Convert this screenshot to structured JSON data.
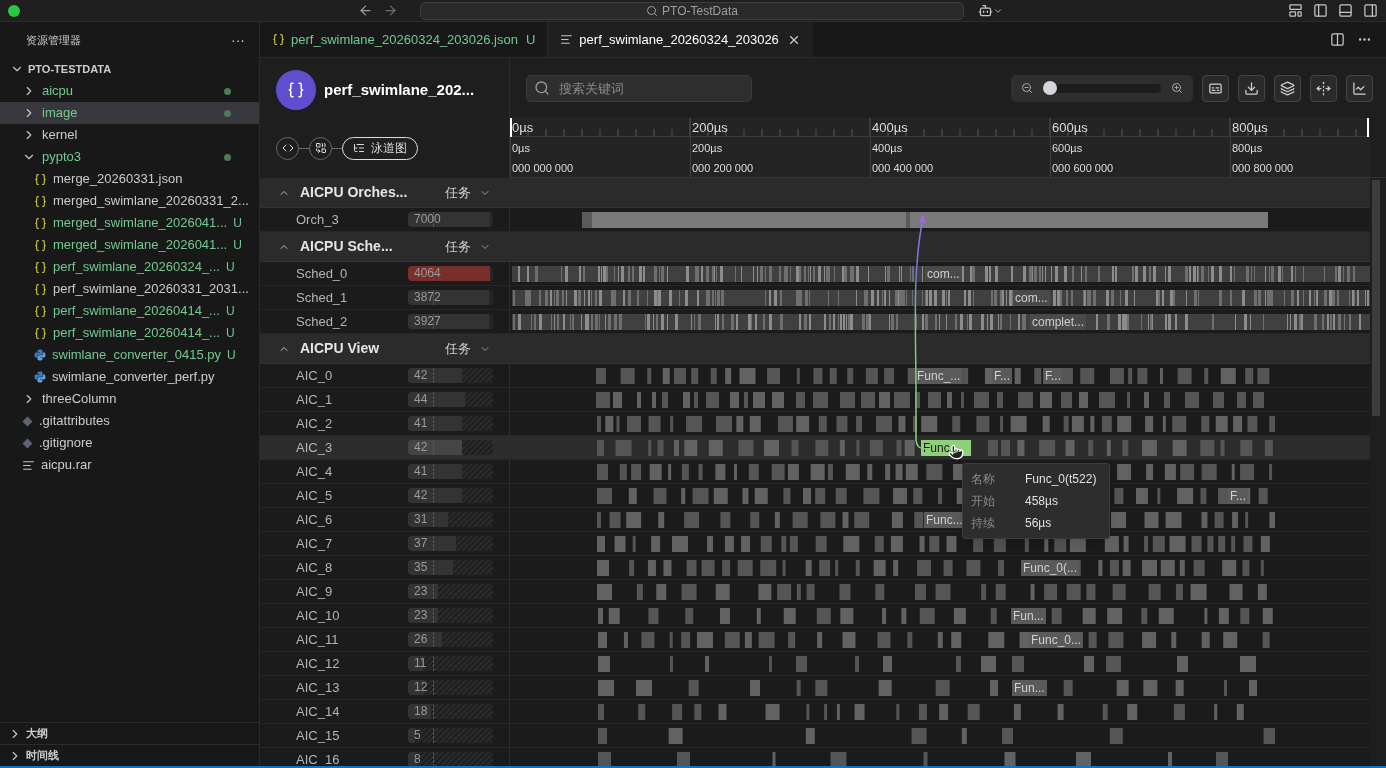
{
  "titlebar": {
    "search": "PTO-TestData"
  },
  "explorer": {
    "title": "资源管理器",
    "more": "···",
    "root": "PTO-TESTDATA",
    "items": [
      {
        "name": "aicpu",
        "kind": "folder",
        "expanded": false,
        "modified": true,
        "selected": false
      },
      {
        "name": "image",
        "kind": "folder",
        "expanded": false,
        "modified": true,
        "selected": true
      },
      {
        "name": "kernel",
        "kind": "folder",
        "expanded": false,
        "modified": false,
        "selected": false
      },
      {
        "name": "pypto3",
        "kind": "folder",
        "expanded": true,
        "modified": true,
        "selected": false,
        "children": [
          {
            "name": "merge_20260331.json",
            "kind": "json",
            "modified": false,
            "selected": false
          },
          {
            "name": "merged_swimlane_20260331_2...",
            "kind": "json",
            "modified": false,
            "selected": false
          },
          {
            "name": "merged_swimlane_2026041...",
            "kind": "json",
            "modified": false,
            "badge": "U",
            "selected": false
          },
          {
            "name": "merged_swimlane_2026041...",
            "kind": "json",
            "modified": false,
            "badge": "U",
            "selected": false
          },
          {
            "name": "perf_swimlane_20260324_...",
            "kind": "json",
            "modified": false,
            "badge": "U",
            "selected": false
          },
          {
            "name": "perf_swimlane_20260331_2031...",
            "kind": "json",
            "modified": false,
            "selected": false
          },
          {
            "name": "perf_swimlane_20260414_...",
            "kind": "json",
            "modified": false,
            "badge": "U",
            "selected": false
          },
          {
            "name": "perf_swimlane_20260414_...",
            "kind": "json",
            "modified": false,
            "badge": "U",
            "selected": false
          },
          {
            "name": "swimlane_converter_0415.py",
            "kind": "python",
            "modified": false,
            "badge": "U",
            "selected": false
          },
          {
            "name": "swimlane_converter_perf.py",
            "kind": "python",
            "modified": false,
            "selected": false
          }
        ]
      },
      {
        "name": "threeColumn",
        "kind": "folder",
        "expanded": false,
        "modified": false,
        "selected": false
      },
      {
        "name": ".gitattributes",
        "kind": "git",
        "modified": false,
        "selected": false
      },
      {
        "name": ".gitignore",
        "kind": "git",
        "modified": false,
        "selected": false
      },
      {
        "name": "aicpu.rar",
        "kind": "text",
        "modified": false,
        "selected": false
      }
    ],
    "panels": [
      "大纲",
      "时间线"
    ]
  },
  "tabs": [
    {
      "label": "perf_swimlane_20260324_203026.json",
      "kind": "json",
      "badge": "U",
      "selected": false
    },
    {
      "label": "perf_swimlane_20260324_203026",
      "kind": "viewer",
      "selected": true
    }
  ],
  "viewer": {
    "title": "perf_swimlane_202...",
    "search": {
      "placeholder": "搜索关键词"
    },
    "zoom": {
      "level": 0
    },
    "steps": [
      {
        "kind": "code",
        "selected": false
      },
      {
        "kind": "convert",
        "selected": false
      },
      {
        "kind": "swimlane",
        "label": "泳道图",
        "selected": true
      }
    ],
    "axis": [
      {
        "major": "0µs",
        "minor": "0µs",
        "ns": "000 000 000"
      },
      {
        "major": "200µs",
        "minor": "200µs",
        "ns": "000 200 000"
      },
      {
        "major": "400µs",
        "minor": "400µs",
        "ns": "000 400 000"
      },
      {
        "major": "600µs",
        "minor": "600µs",
        "ns": "000 600 000"
      },
      {
        "major": "800µs",
        "minor": "800µs",
        "ns": "000 800 000"
      }
    ],
    "groups": [
      {
        "title": "AICPU Orches...",
        "filter": "任务",
        "kind": "single",
        "lanes": [
          {
            "name": "Orch_3",
            "count": "7000",
            "level": 0.97,
            "alert": false,
            "selected": false
          }
        ]
      },
      {
        "title": "AICPU Sche...",
        "filter": "任务",
        "kind": "dense",
        "lanes": [
          {
            "name": "Sched_0",
            "count": "4064",
            "level": 0.97,
            "alert": true,
            "selected": false,
            "labels": [
              {
                "text": "com...",
                "selected": false
              }
            ]
          },
          {
            "name": "Sched_1",
            "count": "3872",
            "level": 0.95,
            "alert": false,
            "selected": false,
            "labels": [
              {
                "text": "com...",
                "selected": false
              }
            ]
          },
          {
            "name": "Sched_2",
            "count": "3927",
            "level": 0.95,
            "alert": false,
            "selected": false,
            "labels": [
              {
                "text": "complet...",
                "selected": false
              }
            ]
          }
        ]
      },
      {
        "title": "AICPU View",
        "filter": "任务",
        "kind": "sparse",
        "lanes": [
          {
            "name": "AIC_0",
            "count": "42",
            "level": 0.64,
            "alert": false,
            "selected": false,
            "labels": [
              {
                "text": "Func_...",
                "selected": false
              },
              {
                "text": "F...",
                "selected": false
              },
              {
                "text": "F...",
                "selected": false
              }
            ]
          },
          {
            "name": "AIC_1",
            "count": "44",
            "level": 0.67,
            "alert": false,
            "selected": false
          },
          {
            "name": "AIC_2",
            "count": "41",
            "level": 0.63,
            "alert": false,
            "selected": false
          },
          {
            "name": "AIC_3",
            "count": "42",
            "level": 0.64,
            "alert": false,
            "selected": true,
            "labels": [
              {
                "text": "Func...",
                "selected": true
              }
            ]
          },
          {
            "name": "AIC_4",
            "count": "41",
            "level": 0.63,
            "alert": false,
            "selected": false
          },
          {
            "name": "AIC_5",
            "count": "42",
            "level": 0.64,
            "alert": false,
            "selected": false,
            "labels": [
              {
                "text": "F...",
                "selected": false
              }
            ]
          },
          {
            "name": "AIC_6",
            "count": "31",
            "level": 0.47,
            "alert": false,
            "selected": false,
            "labels": [
              {
                "text": "Func...",
                "selected": false
              }
            ]
          },
          {
            "name": "AIC_7",
            "count": "37",
            "level": 0.56,
            "alert": false,
            "selected": false
          },
          {
            "name": "AIC_8",
            "count": "35",
            "level": 0.53,
            "alert": false,
            "selected": false,
            "labels": [
              {
                "text": "Func_0(...",
                "selected": false
              }
            ]
          },
          {
            "name": "AIC_9",
            "count": "23",
            "level": 0.35,
            "alert": false,
            "selected": false
          },
          {
            "name": "AIC_10",
            "count": "23",
            "level": 0.35,
            "alert": false,
            "selected": false,
            "labels": [
              {
                "text": "Fun...",
                "selected": false
              }
            ]
          },
          {
            "name": "AIC_11",
            "count": "26",
            "level": 0.4,
            "alert": false,
            "selected": false,
            "labels": [
              {
                "text": "Func_0...",
                "selected": false
              }
            ]
          },
          {
            "name": "AIC_12",
            "count": "11",
            "level": 0.18,
            "alert": false,
            "selected": false
          },
          {
            "name": "AIC_13",
            "count": "12",
            "level": 0.19,
            "alert": false,
            "selected": false,
            "labels": [
              {
                "text": "Fun...",
                "selected": false
              }
            ]
          },
          {
            "name": "AIC_14",
            "count": "18",
            "level": 0.27,
            "alert": false,
            "selected": false
          },
          {
            "name": "AIC_15",
            "count": "5",
            "level": 0.08,
            "alert": false,
            "selected": false
          },
          {
            "name": "AIC_16",
            "count": "8",
            "level": 0.11,
            "alert": false,
            "selected": false
          }
        ]
      }
    ],
    "tooltip": [
      {
        "key": "名称",
        "value": "Func_0(t522)"
      },
      {
        "key": "开始",
        "value": "458µs"
      },
      {
        "key": "持续",
        "value": "56µs"
      }
    ]
  }
}
